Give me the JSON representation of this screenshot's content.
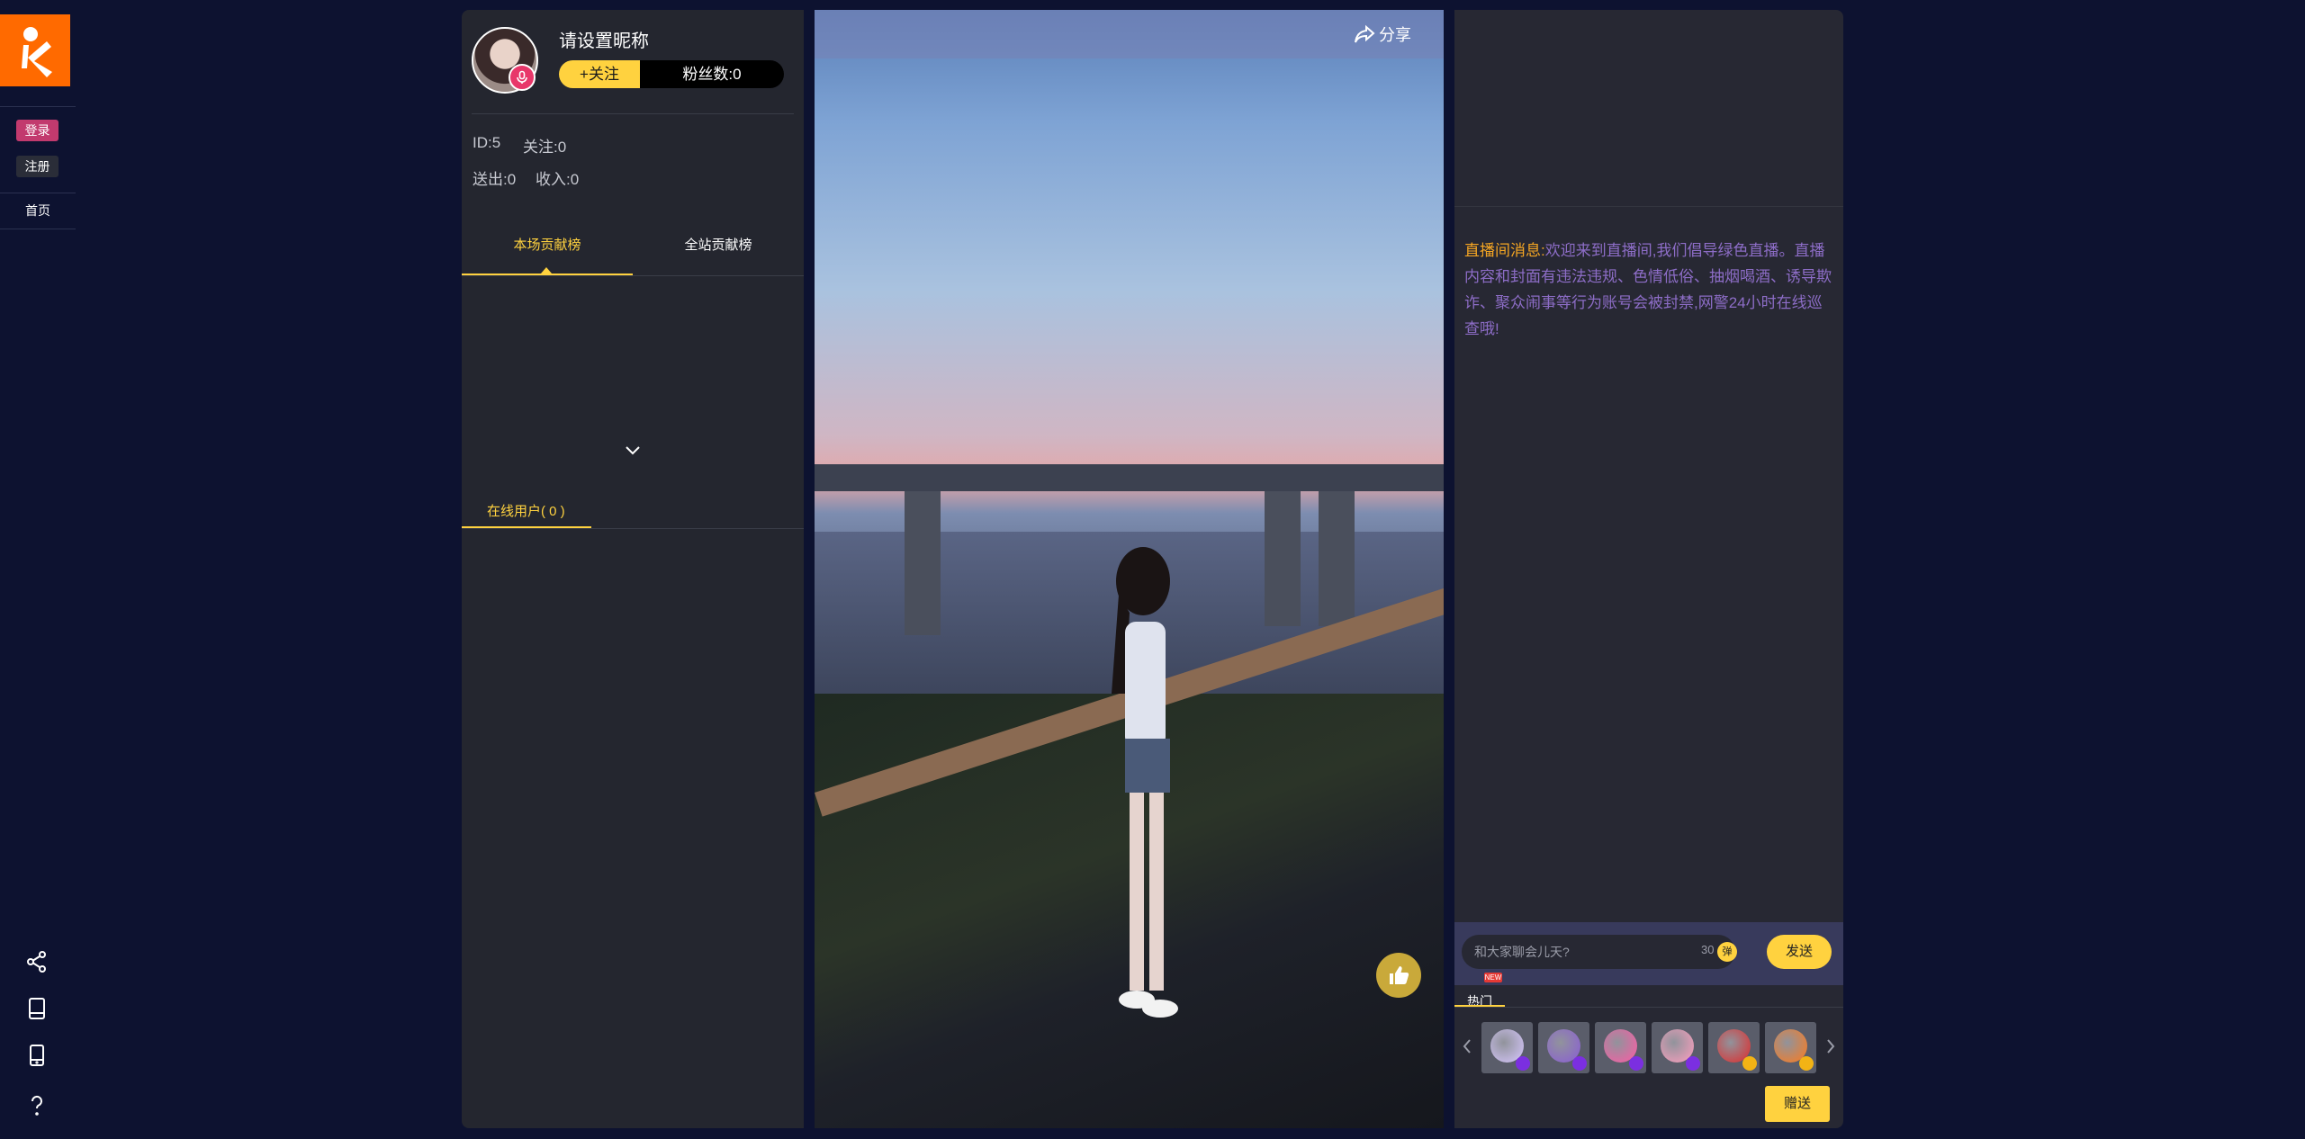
{
  "nav": {
    "login": "登录",
    "register": "注册",
    "home": "首页",
    "icons": [
      "share-network-icon",
      "tablet-icon",
      "phone-icon",
      "help-icon"
    ]
  },
  "anchor": {
    "nickname": "请设置昵称",
    "follow": "+关注",
    "fans": "粉丝数:0",
    "id": "ID:5",
    "following": "关注:0",
    "sent": "送出:0",
    "income": "收入:0"
  },
  "rank_tabs": {
    "this_show": "本场贡献榜",
    "site_wide": "全站贡献榜"
  },
  "online": {
    "label": "在线用户( 0 )"
  },
  "video": {
    "share": "分享"
  },
  "chat": {
    "notice_label": "直播间消息:",
    "notice_text": "欢迎来到直播间,我们倡导绿色直播。直播内容和封面有违法违规、色情低俗、抽烟喝酒、诱导欺诈、聚众闹事等行为账号会被封禁,网警24小时在线巡查哦!",
    "input_placeholder": "和大家聊会儿天?",
    "char_count": "30",
    "danmu_badge": "弹",
    "send": "发送"
  },
  "gifts": {
    "tab_hot": "热门",
    "new_badge": "NEW",
    "give": "赠送",
    "items": [
      {
        "name": "gift-sparkle",
        "color": "#d8c8ff",
        "badge": "#7b2fe0"
      },
      {
        "name": "gift-potion",
        "color": "#8a5cd6",
        "badge": "#7b2fe0"
      },
      {
        "name": "gift-donut",
        "color": "#ff5aa5",
        "badge": "#7b2fe0"
      },
      {
        "name": "gift-hand",
        "color": "#ff9fbf",
        "badge": "#7b2fe0"
      },
      {
        "name": "gift-heels",
        "color": "#e02a2a",
        "badge": "#f2b315"
      },
      {
        "name": "gift-rocket",
        "color": "#ff7a1a",
        "badge": "#f2b315"
      }
    ]
  },
  "colors": {
    "accent": "#ffd23f",
    "brand": "#ff6a00",
    "login": "#c23a6e",
    "notice_label": "#f5a623",
    "notice_text": "#8d6dc7"
  }
}
